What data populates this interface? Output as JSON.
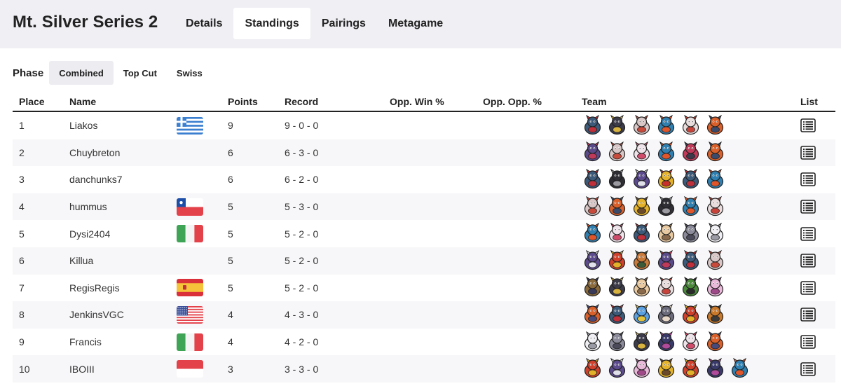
{
  "app": {
    "title": "Mt. Silver Series 2"
  },
  "tabs": [
    {
      "label": "Details",
      "active": false
    },
    {
      "label": "Standings",
      "active": true
    },
    {
      "label": "Pairings",
      "active": false
    },
    {
      "label": "Metagame",
      "active": false
    }
  ],
  "phase": {
    "label": "Phase",
    "options": [
      {
        "label": "Combined",
        "active": true
      },
      {
        "label": "Top Cut",
        "active": false
      },
      {
        "label": "Swiss",
        "active": false
      }
    ]
  },
  "table": {
    "headers": {
      "place": "Place",
      "name": "Name",
      "points": "Points",
      "record": "Record",
      "opp_win": "Opp. Win %",
      "opp_opp": "Opp. Opp. %",
      "team": "Team",
      "list": "List"
    },
    "rows": [
      {
        "place": "1",
        "name": "Liakos",
        "flag": "greece-flag",
        "points": "9",
        "record": "9 - 0 - 0",
        "team": [
          [
            "dark-bird-icon",
            "#3c5a7a",
            "#c0303a"
          ],
          [
            "dark-beast-icon",
            "#3b3b4a",
            "#d9b340"
          ],
          [
            "mushroom-icon",
            "#d8c6c6",
            "#c84a3a"
          ],
          [
            "water-dragon-icon",
            "#2f7fb0",
            "#e0562a"
          ],
          [
            "white-beast-icon",
            "#e9dcdc",
            "#c8443a"
          ],
          [
            "fire-fox-icon",
            "#d9602a",
            "#3c4a6a"
          ]
        ]
      },
      {
        "place": "2",
        "name": "Chuybreton",
        "flag": "",
        "points": "6",
        "record": "6 - 3 - 0",
        "team": [
          [
            "ghost-serpent-icon",
            "#5b4a8a",
            "#c03a5a"
          ],
          [
            "mushroom-icon",
            "#d8c6c6",
            "#c84a3a"
          ],
          [
            "white-fairy-icon",
            "#efe3ea",
            "#d04a6a"
          ],
          [
            "water-dragon-icon",
            "#2f7fb0",
            "#e0562a"
          ],
          [
            "pink-bug-icon",
            "#c23a5a",
            "#3a3a4a"
          ],
          [
            "fire-fox-icon",
            "#d9602a",
            "#3c4a6a"
          ]
        ]
      },
      {
        "place": "3",
        "name": "danchunks7",
        "flag": "",
        "points": "6",
        "record": "6 - 2 - 0",
        "team": [
          [
            "dark-bird-icon",
            "#3c5a7a",
            "#c0303a"
          ],
          [
            "dark-boar-icon",
            "#2e2e34",
            "#9a9aa0"
          ],
          [
            "ghost-icon",
            "#5c4a8e",
            "#e0e0ea"
          ],
          [
            "yellow-fire-icon",
            "#e4b22a",
            "#c8302a"
          ],
          [
            "dark-bird-icon",
            "#3c5a7a",
            "#c0303a"
          ],
          [
            "water-dragon-icon",
            "#2f7fb0",
            "#e0562a"
          ]
        ]
      },
      {
        "place": "4",
        "name": "hummus",
        "flag": "chile-flag",
        "points": "5",
        "record": "5 - 3 - 0",
        "team": [
          [
            "mushroom-icon",
            "#d8c6c6",
            "#c84a3a"
          ],
          [
            "fire-fox-icon",
            "#d9602a",
            "#3c4a6a"
          ],
          [
            "yellow-imp-icon",
            "#e4b22a",
            "#6a4a2a"
          ],
          [
            "dark-boar-icon",
            "#2e2e34",
            "#9a9aa0"
          ],
          [
            "water-dragon-icon",
            "#2f7fb0",
            "#e0562a"
          ],
          [
            "white-beast-icon",
            "#e9dcdc",
            "#c8443a"
          ]
        ]
      },
      {
        "place": "5",
        "name": "Dysi2404",
        "flag": "italy-flag",
        "points": "5",
        "record": "5 - 2 - 0",
        "team": [
          [
            "water-dragon-icon",
            "#2f7fb0",
            "#e0562a"
          ],
          [
            "white-fairy-icon",
            "#efe3ea",
            "#d04a6a"
          ],
          [
            "dark-bird-icon",
            "#3c5a7a",
            "#c0303a"
          ],
          [
            "tan-beast-icon",
            "#e8c9a0",
            "#8a6a4a"
          ],
          [
            "spiky-ghost-icon",
            "#8a8a9a",
            "#4a4a5a"
          ],
          [
            "cloud-icon",
            "#f0f0f4",
            "#9a9aa4"
          ]
        ]
      },
      {
        "place": "6",
        "name": "Killua",
        "flag": "",
        "points": "5",
        "record": "5 - 2 - 0",
        "team": [
          [
            "ghost-icon",
            "#5c4a8e",
            "#e0e0ea"
          ],
          [
            "fire-bird-icon",
            "#d0402a",
            "#e4b22a"
          ],
          [
            "tortoise-icon",
            "#c87a3a",
            "#3a5a3a"
          ],
          [
            "ghost-serpent-icon",
            "#5b4a8a",
            "#c03a5a"
          ],
          [
            "dark-bird-icon",
            "#3c5a7a",
            "#c0303a"
          ],
          [
            "mushroom-icon",
            "#d8c6c6",
            "#c84a3a"
          ]
        ]
      },
      {
        "place": "7",
        "name": "RegisRegis",
        "flag": "spain-flag",
        "points": "5",
        "record": "5 - 2 - 0",
        "team": [
          [
            "brown-beast-icon",
            "#8a6a3a",
            "#3a3a5a"
          ],
          [
            "dark-beast-icon",
            "#3b3b4a",
            "#d9b340"
          ],
          [
            "tan-beast-icon",
            "#e8c9a0",
            "#8a6a4a"
          ],
          [
            "white-beast-icon",
            "#e9dcdc",
            "#c8443a"
          ],
          [
            "green-cat-icon",
            "#4a8a3a",
            "#2a2a2a"
          ],
          [
            "pink-fairy-icon",
            "#e8b8d8",
            "#a04a8a"
          ]
        ]
      },
      {
        "place": "8",
        "name": "JenkinsVGC",
        "flag": "usa-flag",
        "points": "4",
        "record": "4 - 3 - 0",
        "team": [
          [
            "orange-bird-icon",
            "#d9602a",
            "#4a4a7a"
          ],
          [
            "dark-bird-icon",
            "#3c5a7a",
            "#c0303a"
          ],
          [
            "blue-yellow-icon",
            "#5aa0e0",
            "#e4c23a"
          ],
          [
            "grey-beast-icon",
            "#6a6a7a",
            "#e8d8c8"
          ],
          [
            "fire-bird-icon",
            "#d0402a",
            "#e4b22a"
          ],
          [
            "deer-icon",
            "#c8782a",
            "#3a3a3a"
          ]
        ]
      },
      {
        "place": "9",
        "name": "Francis",
        "flag": "italy-flag",
        "points": "4",
        "record": "4 - 2 - 0",
        "team": [
          [
            "cloud-icon",
            "#f0f0f4",
            "#9a9aa4"
          ],
          [
            "spiky-ghost-icon",
            "#8a8a9a",
            "#4a4a5a"
          ],
          [
            "dark-beast-icon",
            "#3b3b4a",
            "#d9b340"
          ],
          [
            "dark-bug-icon",
            "#3a3a6a",
            "#b04a9a"
          ],
          [
            "white-fairy-icon",
            "#efe3ea",
            "#d04a6a"
          ],
          [
            "orange-bird-icon",
            "#d9602a",
            "#4a4a7a"
          ]
        ]
      },
      {
        "place": "10",
        "name": "IBOIII",
        "flag": "indonesia-flag",
        "points": "3",
        "record": "3 - 3 - 0",
        "team": [
          [
            "fire-bird-icon",
            "#d0402a",
            "#e4b22a"
          ],
          [
            "ghost-icon",
            "#5c4a8e",
            "#e0e0ea"
          ],
          [
            "pink-fairy-icon",
            "#e8b8d8",
            "#a04a8a"
          ],
          [
            "yellow-imp-icon",
            "#e4b22a",
            "#6a4a2a"
          ],
          [
            "fire-bird-icon",
            "#d0402a",
            "#e4b22a"
          ],
          [
            "dark-bug-icon",
            "#3a3a6a",
            "#b04a9a"
          ],
          [
            "water-dragon-icon",
            "#2f7fb0",
            "#e0562a"
          ]
        ]
      }
    ]
  }
}
